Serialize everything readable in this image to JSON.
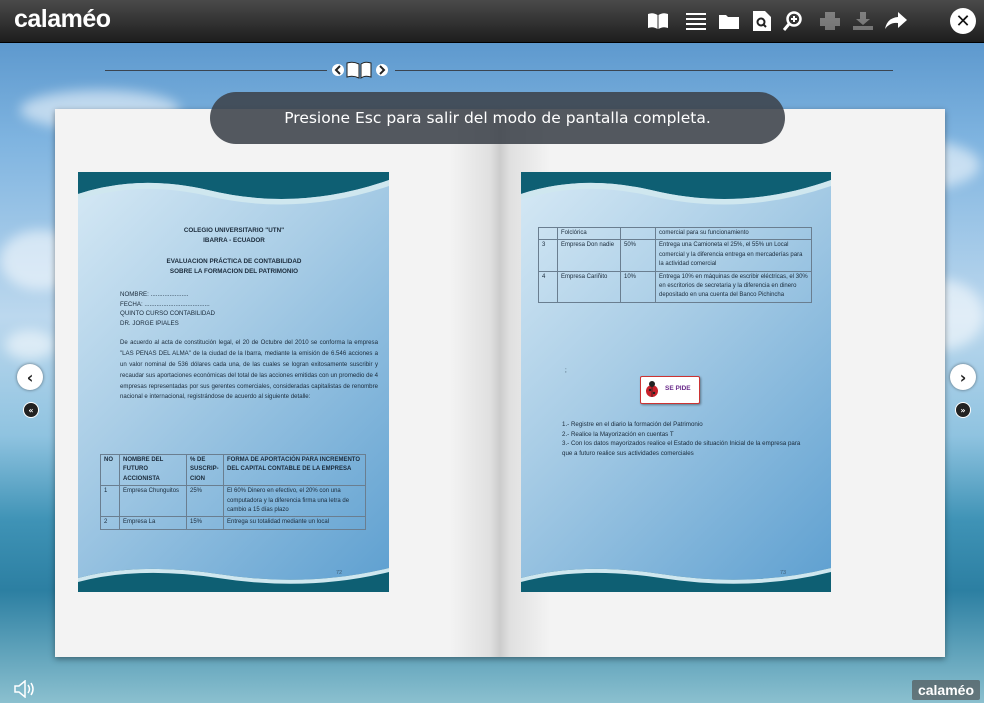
{
  "app": {
    "logo": "calaméo",
    "watermark": "calaméo"
  },
  "toolbar": {
    "icons": [
      "book-view-icon",
      "list-view-icon",
      "folder-icon",
      "search-document-icon",
      "zoom-icon",
      "print-icon",
      "download-icon",
      "share-icon",
      "close-icon"
    ],
    "close_glyph": "✕"
  },
  "tooltip": {
    "text": "Presione Esc para salir del modo de pantalla completa."
  },
  "left_page": {
    "header1": "COLEGIO UNIVERSITARIO \"UTN\"",
    "header2": "IBARRA - ECUADOR",
    "title1": "EVALUACION PRÁCTICA DE CONTABILIDAD",
    "title2": "SOBRE LA FORMACION DEL PATRIMONIO",
    "fields": [
      "NOMBRE: ......................",
      "FECHA: ......................................",
      "QUINTO CURSO CONTABILIDAD",
      "DR. JORGE IPIALES"
    ],
    "paragraph": "De acuerdo al acta de constitución legal, el 20 de Octubre del 2010 se conforma la empresa \"LAS PENAS DEL ALMA\" de la ciudad de la Ibarra, mediante la emisión de 6.546 acciones a un valor nominal de 536 dólares cada una, de las cuales se logran exitosamente suscribir y recaudar sus aportaciones económicas del total de las acciones emitidas con un promedio de 4 empresas representadas por sus gerentes comerciales, consideradas capitalistas de renombre nacional e internacional, registrándose de acuerdo al siguiente detalle:",
    "table_headers": [
      "NO",
      "NOMBRE DEL FUTURO ACCIONISTA",
      "% DE SUSCRIP-CION",
      "FORMA DE APORTACIÓN PARA INCREMENTO DEL CAPITAL CONTABLE DE LA EMPRESA"
    ],
    "table_rows": [
      [
        "1",
        "Empresa Chunguitos",
        "25%",
        "El 60% Dinero en efectivo, el 20% con una computadora y la diferencia firma una letra de cambio a 15 días plazo"
      ],
      [
        "2",
        "Empresa La",
        "15%",
        "Entrega su totalidad mediante un local"
      ]
    ],
    "page_number": "72"
  },
  "right_page": {
    "table_rows": [
      [
        "",
        "Folclórica",
        "",
        "comercial para su funcionamiento"
      ],
      [
        "3",
        "Empresa Don nadie",
        "50%",
        "Entrega una Camioneta el 25%, el 55% un Local comercial y la diferencia entrega en mercaderías para la actividad comercial"
      ],
      [
        "4",
        "Empresa Cariñito",
        "10%",
        "Entrega 10% en máquinas de escribir eléctricas, el 30% en escritorios de secretaria y la diferencia en dinero depositado en una cuenta del Banco Pichincha"
      ]
    ],
    "marker": ";",
    "badge": "SE PIDE",
    "tasks": [
      "1.- Registre en el diario la formación del Patrimonio",
      "2.- Realice la Mayorización en cuentas T",
      "3.- Con los datos mayorizados realice el Estado de situación Inicial de la empresa para que a futuro realice sus actividades comerciales"
    ],
    "page_number": "73"
  },
  "nav": {
    "prev_glyph": "‹",
    "next_glyph": "›",
    "first_glyph": "«",
    "last_glyph": "»"
  }
}
